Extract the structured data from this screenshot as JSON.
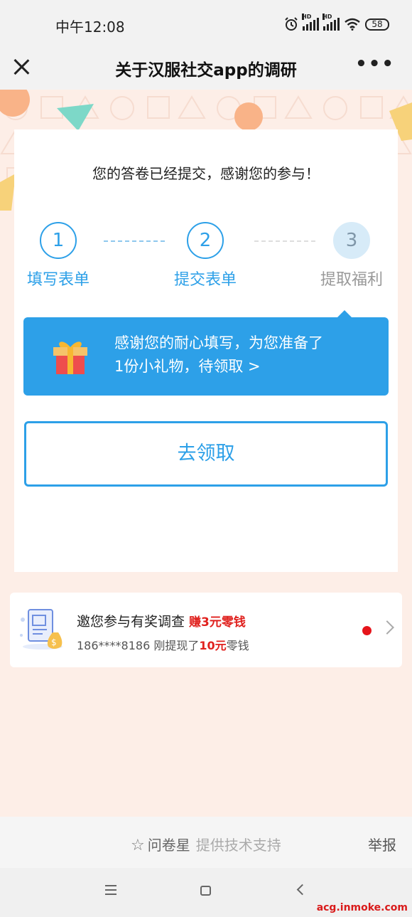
{
  "status_bar": {
    "time": "中午12:08",
    "hd_label": "HD",
    "battery": "58"
  },
  "nav": {
    "title": "关于汉服社交app的调研",
    "more": "•••"
  },
  "card": {
    "message": "您的答卷已经提交，感谢您的参与！",
    "steps": [
      {
        "number": "1",
        "label": "填写表单",
        "state": "done"
      },
      {
        "number": "2",
        "label": "提交表单",
        "state": "done"
      },
      {
        "number": "3",
        "label": "提取福利",
        "state": "current"
      }
    ],
    "tip": {
      "line1": "感谢您的耐心填写，为您准备了",
      "line2": "1份小礼物，待领取 >"
    },
    "claim_button": "去领取"
  },
  "promo": {
    "title": "邀您参与有奖调查",
    "reward": "赚3元零钱",
    "sub_prefix": "186****8186 刚提现了",
    "sub_amount": "10元",
    "sub_suffix": "零钱"
  },
  "footer": {
    "star": "☆",
    "brand": "问卷星",
    "support": "提供技术支持",
    "report": "举报"
  },
  "watermark": "acg.inmoke.com",
  "colors": {
    "accent": "#2da0e8",
    "reward_red": "#e0211e",
    "background": "#fdeee7"
  }
}
